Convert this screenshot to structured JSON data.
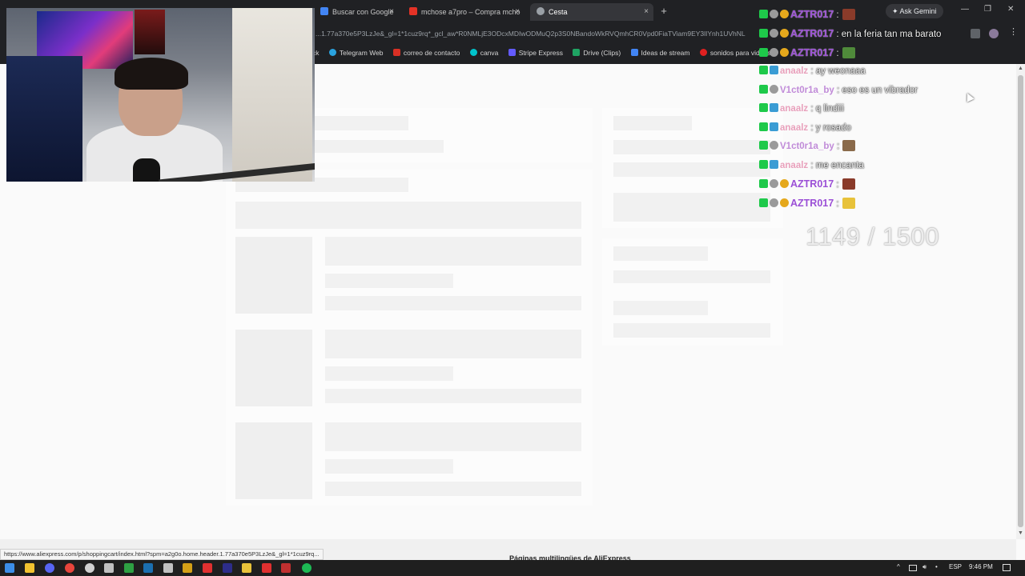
{
  "browser": {
    "tabs": [
      {
        "title": "Buscar con Google",
        "favicon_color": "#4285f4",
        "active": false
      },
      {
        "title": "mchose a7pro – Compra mcho",
        "favicon_color": "#e43226",
        "active": false
      },
      {
        "title": "Cesta",
        "favicon_color": "#9aa0a6",
        "active": true
      }
    ],
    "new_tab_label": "+",
    "close_glyph": "×",
    "ask_gemini_label": "Ask Gemini",
    "window_controls": {
      "minimize": "—",
      "restore": "❐",
      "close": "✕"
    },
    "url": "...1.77a370e5P3LzJe&_gl=1*1cuz9rq*_gcl_aw*R0NMLjE3ODcxMDIwODMuQ2p3S0NBandoWkRVQmhCR0Vpd0FiaTViam9EY3lIYnh1UVhNL",
    "bookmarks": [
      {
        "label": "ck",
        "color": "#777777"
      },
      {
        "label": "Telegram Web",
        "color": "#2aa3e0"
      },
      {
        "label": "correo de contacto",
        "color": "#d93025"
      },
      {
        "label": "canva",
        "color": "#00c4cc"
      },
      {
        "label": "Stripe Express",
        "color": "#635bff"
      },
      {
        "label": "Drive (Clips)",
        "color": "#1fa463"
      },
      {
        "label": "Ideas de stream",
        "color": "#4285f4"
      },
      {
        "label": "sonidos para videos",
        "color": "#e02020"
      }
    ]
  },
  "chat": {
    "messages": [
      {
        "user": "AZTR017",
        "sep": " :",
        "text": "",
        "user_color": "#9b4fd6",
        "badges": [
          "k",
          "m",
          "g"
        ],
        "emote": "#8a3b2a"
      },
      {
        "user": "AZTR017",
        "sep": " :",
        "text": " en la feria tan ma barato",
        "user_color": "#9b4fd6",
        "badges": [
          "k",
          "m",
          "g"
        ],
        "emote": ""
      },
      {
        "user": "AZTR017",
        "sep": " :",
        "text": "",
        "user_color": "#9b4fd6",
        "badges": [
          "k",
          "m",
          "g"
        ],
        "emote": "#4f8a3a"
      },
      {
        "user": "anaalz",
        "sep": " :",
        "text": " ay weonaaa",
        "user_color": "#e8a0bb",
        "badges": [
          "k",
          "s"
        ],
        "emote": ""
      },
      {
        "user": "V1ct0r1a_by",
        "sep": " :",
        "text": " eso es un vibrador",
        "user_color": "#c08bd8",
        "badges": [
          "k",
          "m"
        ],
        "emote": ""
      },
      {
        "user": "anaalz",
        "sep": " :",
        "text": " q lindiii",
        "user_color": "#e8a0bb",
        "badges": [
          "k",
          "s"
        ],
        "emote": ""
      },
      {
        "user": "anaalz",
        "sep": " :",
        "text": " y rosado",
        "user_color": "#e8a0bb",
        "badges": [
          "k",
          "s"
        ],
        "emote": ""
      },
      {
        "user": "V1ct0r1a_by",
        "sep": " :",
        "text": "",
        "user_color": "#c08bd8",
        "badges": [
          "k",
          "m"
        ],
        "emote": "#8a6a4a"
      },
      {
        "user": "anaalz",
        "sep": " :",
        "text": " me encanta",
        "user_color": "#e8a0bb",
        "badges": [
          "k",
          "s"
        ],
        "emote": ""
      },
      {
        "user": "AZTR017",
        "sep": " :",
        "text": "",
        "user_color": "#9b4fd6",
        "badges": [
          "k",
          "m",
          "g"
        ],
        "emote": "#8a3b2a"
      },
      {
        "user": "AZTR017",
        "sep": " :",
        "text": "",
        "user_color": "#9b4fd6",
        "badges": [
          "k",
          "m",
          "g"
        ],
        "emote": "#e8c23a"
      }
    ]
  },
  "overlay": {
    "counter": "1149 / 1500"
  },
  "page": {
    "footer_text": "Páginas multilingües de AliExpress"
  },
  "status_bar": {
    "url": "https://www.aliexpress.com/p/shoppingcart/index.html?spm=a2g0o.home.header.1.77a370e5P3LzJe&_gl=1*1cuz9rq..."
  },
  "taskbar": {
    "language": "ESP",
    "time": "9:46 PM",
    "apps": [
      {
        "name": "start",
        "color": "#3c8ee8"
      },
      {
        "name": "file-explorer",
        "color": "#f2c230"
      },
      {
        "name": "discord",
        "color": "#5865f2"
      },
      {
        "name": "chrome",
        "color": "#e8453c"
      },
      {
        "name": "obs",
        "color": "#d0d0d0"
      },
      {
        "name": "app-6",
        "color": "#c0c0c0"
      },
      {
        "name": "app-7",
        "color": "#2ea043"
      },
      {
        "name": "steam",
        "color": "#1b6fb0"
      },
      {
        "name": "app-9",
        "color": "#c0c0c0"
      },
      {
        "name": "app-10",
        "color": "#d4a017"
      },
      {
        "name": "app-11",
        "color": "#e03030"
      },
      {
        "name": "premiere",
        "color": "#2d2d8a"
      },
      {
        "name": "app-13",
        "color": "#e8c23a"
      },
      {
        "name": "app-14",
        "color": "#e03030"
      },
      {
        "name": "app-15",
        "color": "#c03030"
      },
      {
        "name": "spotify",
        "color": "#1db954"
      }
    ]
  }
}
